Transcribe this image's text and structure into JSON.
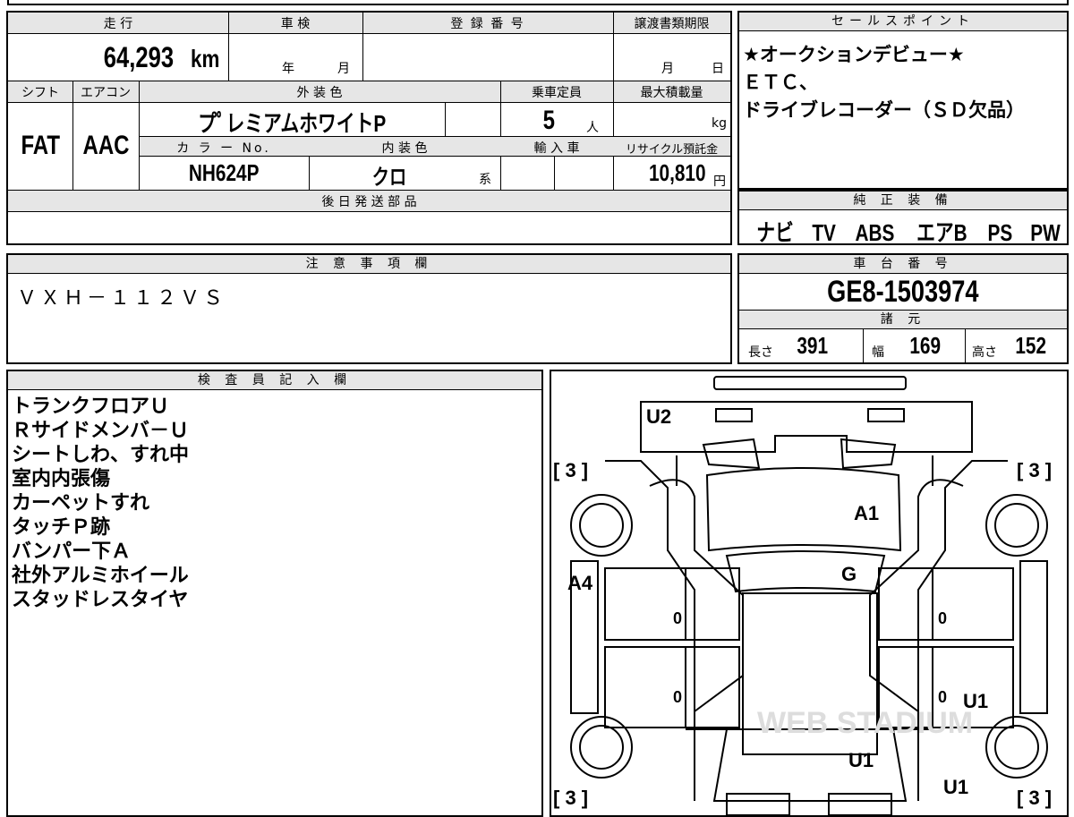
{
  "top_strip": [
    "",
    "",
    "",
    "",
    ""
  ],
  "spec": {
    "mileage_label": "走 行",
    "mileage_value": "64,293",
    "mileage_unit": "km",
    "shaken_label": "車 検",
    "shaken_year": "年",
    "shaken_month": "月",
    "reg_label": "登 録 番 号",
    "transfer_label": "譲渡書類期限",
    "transfer_month": "月",
    "transfer_day": "日",
    "shift_label": "シフト",
    "ac_label": "エアコン",
    "color_label": "外 装 色",
    "seats_label": "乗車定員",
    "payload_label": "最大積載量",
    "shift_value": "FAT",
    "ac_value": "AAC",
    "color_value": "プﾟレミアムホワイトP",
    "seats_value": "5",
    "seats_unit": "人",
    "payload_unit": "kg",
    "colorno_label": "カ ラ ー No.",
    "interior_label": "内 装 色",
    "import_label": "輸 入 車",
    "recycle_label": "リサイクル預託金",
    "colorno_value": "NH624P",
    "interior_value": "クロ",
    "interior_suffix": "系",
    "recycle_value": "10,810",
    "recycle_unit": "円",
    "later_parts_label": "後 日 発 送 部 品",
    "later_parts_value": ""
  },
  "sales": {
    "label": "セールスポイント",
    "lines": [
      "★オークションデビュー★",
      "ＥＴＣ、",
      "ドライブレコーダー（ＳＤ欠品）"
    ]
  },
  "equipment": {
    "label": "純 正 装 備",
    "items": [
      "ナビ",
      "TV",
      "ABS",
      "エアB",
      "PS",
      "PW"
    ]
  },
  "caution": {
    "label": "注 意 事 項 欄",
    "text": "ＶＸＨ－１１２ＶＳ"
  },
  "chassis": {
    "label": "車 台 番 号",
    "value": "GE8-1503974",
    "dims_label": "諸 元",
    "length_label": "長さ",
    "length_value": "391",
    "width_label": "幅",
    "width_value": "169",
    "height_label": "高さ",
    "height_value": "152"
  },
  "inspector": {
    "label": "検 査 員 記 入 欄",
    "notes": [
      "トランクフロアＵ",
      "Ｒサイドメンバ－Ｕ",
      "シートしわ、すれ中",
      "室内内張傷",
      "カーペットすれ",
      "タッチＰ跡",
      "バンパー下Ａ",
      "社外アルミホイール",
      "スタッドレスタイヤ"
    ]
  },
  "diagram": {
    "marks": {
      "rear_bumper": "U2",
      "hatch": "A1",
      "rear_glass": "G",
      "left_quarter": "A4",
      "right_rear_door": "U1",
      "hood": "U1",
      "front_bumper_right": "U1",
      "left_rear_door_val": "0",
      "left_front_door_val": "0",
      "right_rear_door_val": "0",
      "right_front_door_val": "0"
    },
    "tire_tread": "[ 3 ]",
    "watermark": "WEB STADIUM"
  }
}
